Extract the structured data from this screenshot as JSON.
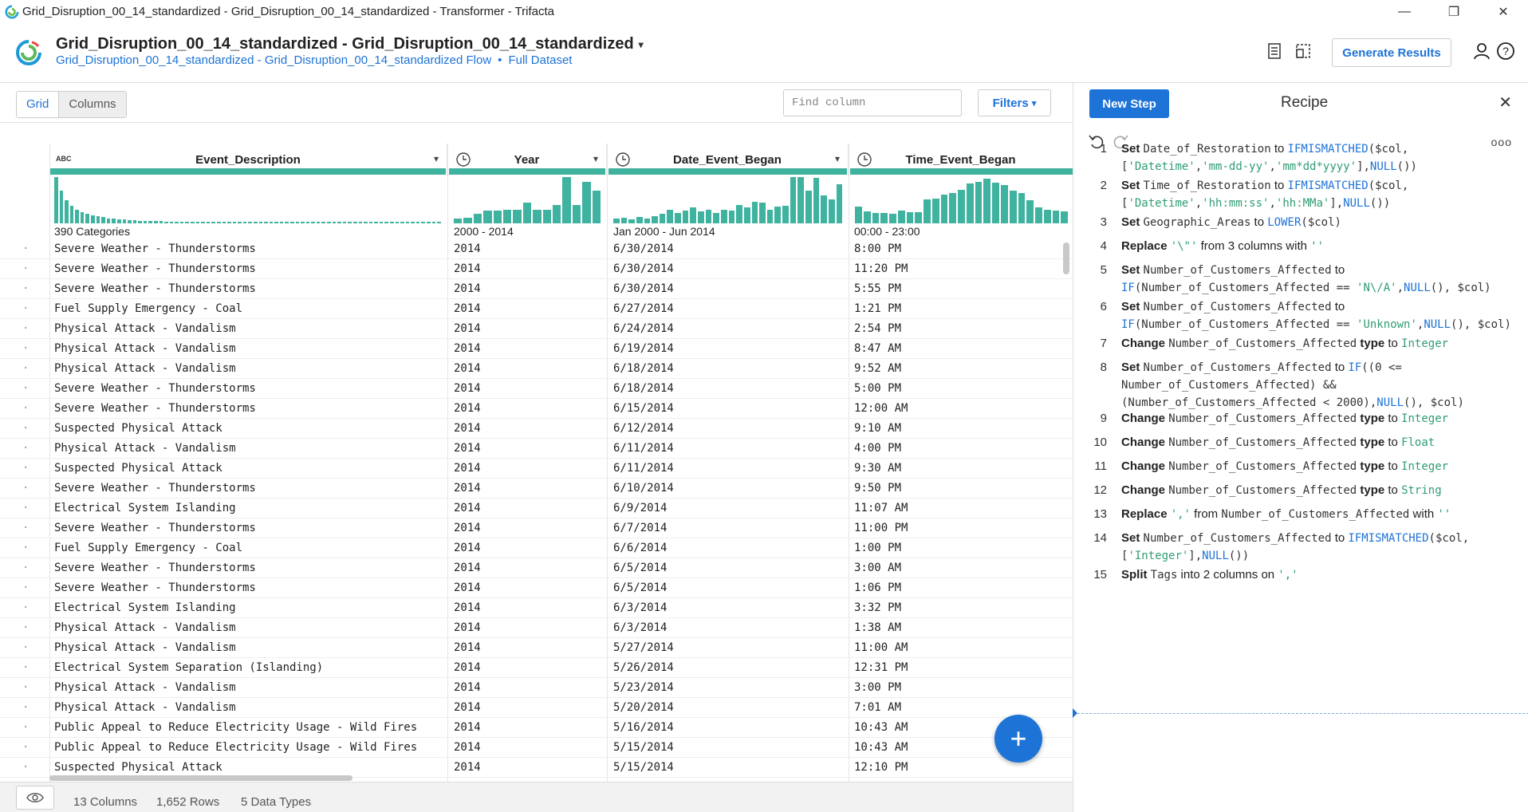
{
  "window": {
    "title": "Grid_Disruption_00_14_standardized - Grid_Disruption_00_14_standardized - Transformer - Trifacta",
    "minimize": "—",
    "restore": "❐",
    "close": "✕"
  },
  "header": {
    "flow_name": "Grid_Disruption_00_14_standardized - Grid_Disruption_00_14_standardized",
    "flow_link": "Grid_Disruption_00_14_standardized - Grid_Disruption_00_14_standardized Flow",
    "separator": "•",
    "dataset_link": "Full Dataset",
    "generate_button": "Generate Results"
  },
  "toolbar": {
    "grid_label": "Grid",
    "columns_label": "Columns",
    "find_placeholder": "Find column",
    "filters_label": "Filters"
  },
  "columns": [
    {
      "name": "Event_Description",
      "type_label": "ABC",
      "range": "390 Categories"
    },
    {
      "name": "Year",
      "type_label": "",
      "range": "2000 - 2014"
    },
    {
      "name": "Date_Event_Began",
      "type_label": "",
      "range": "Jan 2000 - Jun 2014"
    },
    {
      "name": "Time_Event_Began",
      "type_label": "",
      "range": "00:00 - 23:00"
    }
  ],
  "histograms": {
    "event_description": [
      100,
      70,
      50,
      38,
      30,
      24,
      20,
      17,
      15,
      13,
      11,
      10,
      9,
      8,
      7,
      7,
      6,
      6,
      5,
      5,
      5,
      4,
      4,
      4,
      4,
      4,
      4,
      4,
      4,
      4,
      4,
      4,
      4,
      4,
      4,
      4,
      4,
      4,
      4,
      4,
      4,
      4,
      4,
      4,
      4,
      4,
      4,
      4,
      4,
      4,
      4,
      4,
      4,
      4,
      4,
      4,
      4,
      4,
      4,
      4,
      4,
      4,
      4,
      4,
      4,
      4,
      4,
      4,
      4,
      4,
      4,
      4,
      4,
      4
    ],
    "year": [
      10,
      12,
      20,
      28,
      28,
      30,
      30,
      45,
      30,
      30,
      40,
      100,
      40,
      90,
      70
    ],
    "date": [
      10,
      12,
      8,
      14,
      10,
      16,
      20,
      30,
      22,
      28,
      34,
      26,
      30,
      22,
      30,
      28,
      40,
      34,
      46,
      44,
      30,
      36,
      38,
      100,
      100,
      70,
      98,
      60,
      52,
      84
    ],
    "time": [
      36,
      26,
      22,
      22,
      20,
      28,
      24,
      24,
      52,
      54,
      62,
      66,
      72,
      86,
      90,
      96,
      88,
      82,
      70,
      66,
      50,
      34,
      30,
      28,
      26
    ]
  },
  "rows": [
    {
      "desc": "Severe Weather - Thunderstorms",
      "year": "2014",
      "date": "6/30/2014",
      "time": "8:00 PM"
    },
    {
      "desc": "Severe Weather - Thunderstorms",
      "year": "2014",
      "date": "6/30/2014",
      "time": "11:20 PM"
    },
    {
      "desc": "Severe Weather - Thunderstorms",
      "year": "2014",
      "date": "6/30/2014",
      "time": "5:55 PM"
    },
    {
      "desc": "Fuel Supply Emergency - Coal",
      "year": "2014",
      "date": "6/27/2014",
      "time": "1:21 PM"
    },
    {
      "desc": "Physical Attack - Vandalism",
      "year": "2014",
      "date": "6/24/2014",
      "time": "2:54 PM"
    },
    {
      "desc": "Physical Attack - Vandalism",
      "year": "2014",
      "date": "6/19/2014",
      "time": "8:47 AM"
    },
    {
      "desc": "Physical Attack - Vandalism",
      "year": "2014",
      "date": "6/18/2014",
      "time": "9:52 AM"
    },
    {
      "desc": "Severe Weather - Thunderstorms",
      "year": "2014",
      "date": "6/18/2014",
      "time": "5:00 PM"
    },
    {
      "desc": "Severe Weather - Thunderstorms",
      "year": "2014",
      "date": "6/15/2014",
      "time": "12:00 AM"
    },
    {
      "desc": "Suspected Physical Attack",
      "year": "2014",
      "date": "6/12/2014",
      "time": "9:10 AM"
    },
    {
      "desc": "Physical Attack - Vandalism",
      "year": "2014",
      "date": "6/11/2014",
      "time": "4:00 PM"
    },
    {
      "desc": "Suspected Physical Attack",
      "year": "2014",
      "date": "6/11/2014",
      "time": "9:30 AM"
    },
    {
      "desc": "Severe Weather - Thunderstorms",
      "year": "2014",
      "date": "6/10/2014",
      "time": "9:50 PM"
    },
    {
      "desc": "Electrical System Islanding",
      "year": "2014",
      "date": "6/9/2014",
      "time": "11:07 AM"
    },
    {
      "desc": "Severe Weather - Thunderstorms",
      "year": "2014",
      "date": "6/7/2014",
      "time": "11:00 PM"
    },
    {
      "desc": "Fuel Supply Emergency - Coal",
      "year": "2014",
      "date": "6/6/2014",
      "time": "1:00 PM"
    },
    {
      "desc": "Severe Weather - Thunderstorms",
      "year": "2014",
      "date": "6/5/2014",
      "time": "3:00 AM"
    },
    {
      "desc": "Severe Weather - Thunderstorms",
      "year": "2014",
      "date": "6/5/2014",
      "time": "1:06 PM"
    },
    {
      "desc": "Electrical System Islanding",
      "year": "2014",
      "date": "6/3/2014",
      "time": "3:32 PM"
    },
    {
      "desc": "Physical Attack - Vandalism",
      "year": "2014",
      "date": "6/3/2014",
      "time": "1:38 AM"
    },
    {
      "desc": "Physical Attack - Vandalism",
      "year": "2014",
      "date": "5/27/2014",
      "time": "11:00 AM"
    },
    {
      "desc": "Electrical System Separation (Islanding)",
      "year": "2014",
      "date": "5/26/2014",
      "time": "12:31 PM"
    },
    {
      "desc": "Physical Attack - Vandalism",
      "year": "2014",
      "date": "5/23/2014",
      "time": "3:00 PM"
    },
    {
      "desc": "Physical Attack - Vandalism",
      "year": "2014",
      "date": "5/20/2014",
      "time": "7:01 AM"
    },
    {
      "desc": "Public Appeal to Reduce Electricity Usage - Wild Fires",
      "year": "2014",
      "date": "5/16/2014",
      "time": "10:43 AM"
    },
    {
      "desc": "Public Appeal to Reduce Electricity Usage - Wild Fires",
      "year": "2014",
      "date": "5/15/2014",
      "time": "10:43 AM"
    },
    {
      "desc": "Suspected Physical Attack",
      "year": "2014",
      "date": "5/15/2014",
      "time": "12:10 PM"
    }
  ],
  "status": {
    "columns": "13 Columns",
    "rows": "1,652 Rows",
    "types": "5 Data Types"
  },
  "recipe": {
    "new_step": "New Step",
    "title": "Recipe",
    "close": "✕",
    "more": "ooo",
    "steps": [
      [
        {
          "c": "num",
          "t": "1"
        },
        {
          "c": "kw",
          "t": "Set "
        },
        {
          "c": "mono",
          "t": "Date_of_Restoration"
        },
        {
          "c": "plain",
          "t": " to "
        },
        {
          "c": "fn",
          "t": "IFMISMATCHED"
        },
        {
          "c": "mono",
          "t": "($col,"
        },
        {
          "c": "br"
        },
        {
          "c": "mono",
          "t": "["
        },
        {
          "c": "str",
          "t": "'Datetime'"
        },
        {
          "c": "mono",
          "t": ","
        },
        {
          "c": "str",
          "t": "'mm-dd-yy'"
        },
        {
          "c": "mono",
          "t": ","
        },
        {
          "c": "str",
          "t": "'mm*dd*yyyy'"
        },
        {
          "c": "mono",
          "t": "],"
        },
        {
          "c": "fn",
          "t": "NULL"
        },
        {
          "c": "mono",
          "t": "())"
        }
      ],
      [
        {
          "c": "num",
          "t": "2"
        },
        {
          "c": "kw",
          "t": "Set "
        },
        {
          "c": "mono",
          "t": "Time_of_Restoration"
        },
        {
          "c": "plain",
          "t": " to "
        },
        {
          "c": "fn",
          "t": "IFMISMATCHED"
        },
        {
          "c": "mono",
          "t": "($col,"
        },
        {
          "c": "br"
        },
        {
          "c": "mono",
          "t": "["
        },
        {
          "c": "str",
          "t": "'Datetime'"
        },
        {
          "c": "mono",
          "t": ","
        },
        {
          "c": "str",
          "t": "'hh:mm:ss'"
        },
        {
          "c": "mono",
          "t": ","
        },
        {
          "c": "str",
          "t": "'hh:MMa'"
        },
        {
          "c": "mono",
          "t": "],"
        },
        {
          "c": "fn",
          "t": "NULL"
        },
        {
          "c": "mono",
          "t": "())"
        }
      ],
      [
        {
          "c": "num",
          "t": "3"
        },
        {
          "c": "kw",
          "t": "Set "
        },
        {
          "c": "mono",
          "t": "Geographic_Areas"
        },
        {
          "c": "plain",
          "t": " to "
        },
        {
          "c": "fn",
          "t": "LOWER"
        },
        {
          "c": "mono",
          "t": "($col)"
        }
      ],
      [
        {
          "c": "num",
          "t": "4"
        },
        {
          "c": "kw",
          "t": "Replace "
        },
        {
          "c": "str",
          "t": "'\\\"'"
        },
        {
          "c": "plain",
          "t": " from 3 columns with "
        },
        {
          "c": "str",
          "t": "''"
        }
      ],
      [
        {
          "c": "num",
          "t": "5"
        },
        {
          "c": "kw",
          "t": "Set "
        },
        {
          "c": "mono",
          "t": "Number_of_Customers_Affected"
        },
        {
          "c": "plain",
          "t": " to"
        },
        {
          "c": "br"
        },
        {
          "c": "fn",
          "t": "IF"
        },
        {
          "c": "mono",
          "t": "(Number_of_Customers_Affected == "
        },
        {
          "c": "str",
          "t": "'N\\/A'"
        },
        {
          "c": "mono",
          "t": ","
        },
        {
          "c": "fn",
          "t": "NULL"
        },
        {
          "c": "mono",
          "t": "(), $col)"
        }
      ],
      [
        {
          "c": "num",
          "t": "6"
        },
        {
          "c": "kw",
          "t": "Set "
        },
        {
          "c": "mono",
          "t": "Number_of_Customers_Affected"
        },
        {
          "c": "plain",
          "t": " to"
        },
        {
          "c": "br"
        },
        {
          "c": "fn",
          "t": "IF"
        },
        {
          "c": "mono",
          "t": "(Number_of_Customers_Affected == "
        },
        {
          "c": "str",
          "t": "'Unknown'"
        },
        {
          "c": "mono",
          "t": ","
        },
        {
          "c": "fn",
          "t": "NULL"
        },
        {
          "c": "mono",
          "t": "(), $col)"
        }
      ],
      [
        {
          "c": "num",
          "t": "7"
        },
        {
          "c": "kw",
          "t": "Change "
        },
        {
          "c": "mono",
          "t": "Number_of_Customers_Affected"
        },
        {
          "c": "kw",
          "t": " type"
        },
        {
          "c": "plain",
          "t": " to "
        },
        {
          "c": "typ",
          "t": "Integer"
        }
      ],
      [
        {
          "c": "num",
          "t": "8"
        },
        {
          "c": "kw",
          "t": "Set "
        },
        {
          "c": "mono",
          "t": "Number_of_Customers_Affected"
        },
        {
          "c": "plain",
          "t": " to "
        },
        {
          "c": "fn",
          "t": "IF"
        },
        {
          "c": "mono",
          "t": "((0 <="
        },
        {
          "c": "br"
        },
        {
          "c": "mono",
          "t": "Number_of_Customers_Affected) &&"
        },
        {
          "c": "br"
        },
        {
          "c": "mono",
          "t": "(Number_of_Customers_Affected < 2000),"
        },
        {
          "c": "fn",
          "t": "NULL"
        },
        {
          "c": "mono",
          "t": "(), $col)"
        }
      ],
      [
        {
          "c": "num",
          "t": "9"
        },
        {
          "c": "kw",
          "t": "Change "
        },
        {
          "c": "mono",
          "t": "Number_of_Customers_Affected"
        },
        {
          "c": "kw",
          "t": " type"
        },
        {
          "c": "plain",
          "t": " to "
        },
        {
          "c": "typ",
          "t": "Integer"
        }
      ],
      [
        {
          "c": "num",
          "t": "10"
        },
        {
          "c": "kw",
          "t": "Change "
        },
        {
          "c": "mono",
          "t": "Number_of_Customers_Affected"
        },
        {
          "c": "kw",
          "t": " type"
        },
        {
          "c": "plain",
          "t": " to "
        },
        {
          "c": "typ",
          "t": "Float"
        }
      ],
      [
        {
          "c": "num",
          "t": "11"
        },
        {
          "c": "kw",
          "t": "Change "
        },
        {
          "c": "mono",
          "t": "Number_of_Customers_Affected"
        },
        {
          "c": "kw",
          "t": " type"
        },
        {
          "c": "plain",
          "t": " to "
        },
        {
          "c": "typ",
          "t": "Integer"
        }
      ],
      [
        {
          "c": "num",
          "t": "12"
        },
        {
          "c": "kw",
          "t": "Change "
        },
        {
          "c": "mono",
          "t": "Number_of_Customers_Affected"
        },
        {
          "c": "kw",
          "t": " type"
        },
        {
          "c": "plain",
          "t": " to "
        },
        {
          "c": "typ",
          "t": "String"
        }
      ],
      [
        {
          "c": "num",
          "t": "13"
        },
        {
          "c": "kw",
          "t": "Replace "
        },
        {
          "c": "str",
          "t": "','"
        },
        {
          "c": "plain",
          "t": " from "
        },
        {
          "c": "mono",
          "t": "Number_of_Customers_Affected"
        },
        {
          "c": "plain",
          "t": " with "
        },
        {
          "c": "str",
          "t": "''"
        }
      ],
      [
        {
          "c": "num",
          "t": "14"
        },
        {
          "c": "kw",
          "t": "Set "
        },
        {
          "c": "mono",
          "t": "Number_of_Customers_Affected"
        },
        {
          "c": "plain",
          "t": " to "
        },
        {
          "c": "fn",
          "t": "IFMISMATCHED"
        },
        {
          "c": "mono",
          "t": "($col,"
        },
        {
          "c": "br"
        },
        {
          "c": "mono",
          "t": "["
        },
        {
          "c": "str",
          "t": "'Integer'"
        },
        {
          "c": "mono",
          "t": "],"
        },
        {
          "c": "fn",
          "t": "NULL"
        },
        {
          "c": "mono",
          "t": "())"
        }
      ],
      [
        {
          "c": "num",
          "t": "15"
        },
        {
          "c": "kw",
          "t": "Split "
        },
        {
          "c": "mono",
          "t": "Tags"
        },
        {
          "c": "plain",
          "t": " into 2 columns on "
        },
        {
          "c": "str",
          "t": "','"
        }
      ]
    ]
  },
  "colors": {
    "accent": "#1d73d6",
    "histogram": "#3fb39f"
  }
}
